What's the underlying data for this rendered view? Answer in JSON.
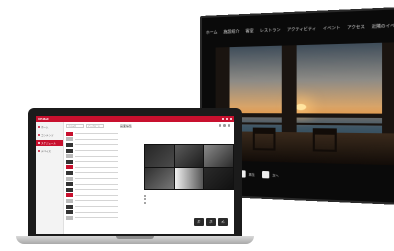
{
  "app": {
    "brand": "UP.Mall"
  },
  "sidebar": {
    "items": [
      {
        "label": "ホーム",
        "active": false
      },
      {
        "label": "コンテンツ",
        "active": false
      },
      {
        "label": "スケジュール",
        "active": true
      },
      {
        "label": "デバイス",
        "active": false
      }
    ]
  },
  "file_panel": {
    "filter_label": "フォルダ",
    "upload_label": "アップロード"
  },
  "main": {
    "title": "画面編集"
  },
  "actions": [
    {
      "icon": "undo",
      "label": "戻す"
    },
    {
      "icon": "redo",
      "label": "進む"
    },
    {
      "icon": "save",
      "label": "保存"
    }
  ],
  "tv": {
    "nav": [
      "ホーム",
      "施設紹介",
      "客室",
      "レストラン",
      "アクティビティ",
      "イベント",
      "アクセス"
    ],
    "nav_right": "近隣のイベント・観光スポット",
    "controls": [
      "前へ",
      "再生",
      "次へ"
    ]
  },
  "colors": {
    "brand": "#c8102e",
    "sunset": "#e59a4c"
  }
}
